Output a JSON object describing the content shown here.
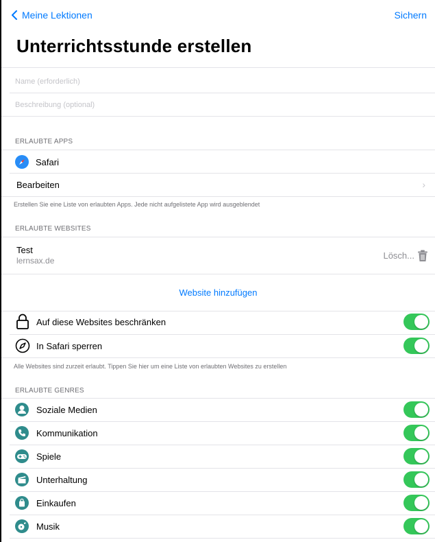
{
  "nav": {
    "back_label": "Meine Lektionen",
    "save_label": "Sichern"
  },
  "page_title": "Unterrichtsstunde erstellen",
  "form": {
    "name_placeholder": "Name (erforderlich)",
    "description_placeholder": "Beschreibung (optional)"
  },
  "apps": {
    "header": "ERLAUBTE APPS",
    "items": [
      {
        "label": "Safari",
        "icon": "safari-icon"
      }
    ],
    "edit_label": "Bearbeiten",
    "footnote": "Erstellen Sie eine Liste von erlaubten Apps. Jede nicht aufgelistete App wird ausgeblendet"
  },
  "websites": {
    "header": "ERLAUBTE WEBSITES",
    "items": [
      {
        "title": "Test",
        "url": "lernsax.de",
        "delete_label": "Lösch..."
      }
    ],
    "add_label": "Website hinzufügen",
    "restrict_label": "Auf diese Websites beschränken",
    "restrict_on": true,
    "lock_safari_label": "In Safari sperren",
    "lock_safari_on": true,
    "footnote": "Alle Websites sind zurzeit erlaubt. Tippen Sie hier um eine Liste von erlaubten Websites zu erstellen"
  },
  "genres": {
    "header": "ERLAUBTE GENRES",
    "items": [
      {
        "label": "Soziale Medien",
        "icon": "social-media-icon",
        "on": true
      },
      {
        "label": "Kommunikation",
        "icon": "phone-icon",
        "on": true
      },
      {
        "label": "Spiele",
        "icon": "gamepad-icon",
        "on": true
      },
      {
        "label": "Unterhaltung",
        "icon": "clapperboard-icon",
        "on": true
      },
      {
        "label": "Einkaufen",
        "icon": "shopping-bag-icon",
        "on": true
      },
      {
        "label": "Musik",
        "icon": "music-icon",
        "on": true
      }
    ]
  },
  "colors": {
    "accent": "#007aff",
    "toggle_on": "#34c759",
    "genre_icon": "#2f8c8c"
  }
}
